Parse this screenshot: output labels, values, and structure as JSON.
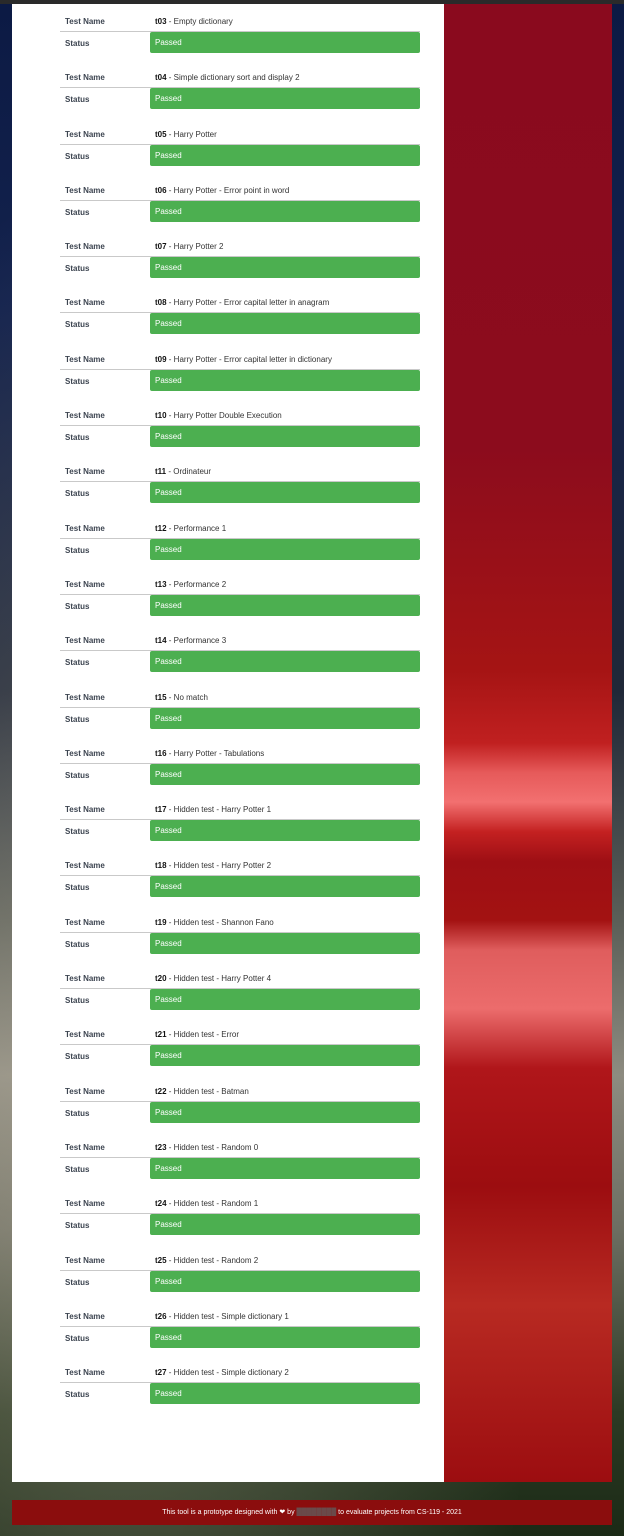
{
  "labels": {
    "test_name": "Test Name",
    "status": "Status",
    "separator": " - "
  },
  "tests": [
    {
      "id": "t03",
      "name": "Empty dictionary",
      "status": "Passed"
    },
    {
      "id": "t04",
      "name": "Simple dictionary sort and display 2",
      "status": "Passed"
    },
    {
      "id": "t05",
      "name": "Harry Potter",
      "status": "Passed"
    },
    {
      "id": "t06",
      "name": "Harry Potter - Error point in word",
      "status": "Passed"
    },
    {
      "id": "t07",
      "name": "Harry Potter 2",
      "status": "Passed"
    },
    {
      "id": "t08",
      "name": "Harry Potter - Error capital letter in anagram",
      "status": "Passed"
    },
    {
      "id": "t09",
      "name": "Harry Potter - Error capital letter in dictionary",
      "status": "Passed"
    },
    {
      "id": "t10",
      "name": "Harry Potter Double Execution",
      "status": "Passed"
    },
    {
      "id": "t11",
      "name": "Ordinateur",
      "status": "Passed"
    },
    {
      "id": "t12",
      "name": "Performance 1",
      "status": "Passed"
    },
    {
      "id": "t13",
      "name": "Performance 2",
      "status": "Passed"
    },
    {
      "id": "t14",
      "name": "Performance 3",
      "status": "Passed"
    },
    {
      "id": "t15",
      "name": "No match",
      "status": "Passed"
    },
    {
      "id": "t16",
      "name": "Harry Potter - Tabulations",
      "status": "Passed"
    },
    {
      "id": "t17",
      "name": "Hidden test - Harry Potter 1",
      "status": "Passed"
    },
    {
      "id": "t18",
      "name": "Hidden test - Harry Potter 2",
      "status": "Passed"
    },
    {
      "id": "t19",
      "name": "Hidden test - Shannon Fano",
      "status": "Passed"
    },
    {
      "id": "t20",
      "name": "Hidden test - Harry Potter 4",
      "status": "Passed"
    },
    {
      "id": "t21",
      "name": "Hidden test - Error",
      "status": "Passed"
    },
    {
      "id": "t22",
      "name": "Hidden test - Batman",
      "status": "Passed"
    },
    {
      "id": "t23",
      "name": "Hidden test - Random 0",
      "status": "Passed"
    },
    {
      "id": "t24",
      "name": "Hidden test - Random 1",
      "status": "Passed"
    },
    {
      "id": "t25",
      "name": "Hidden test - Random 2",
      "status": "Passed"
    },
    {
      "id": "t26",
      "name": "Hidden test - Simple dictionary 1",
      "status": "Passed"
    },
    {
      "id": "t27",
      "name": "Hidden test - Simple dictionary 2",
      "status": "Passed"
    }
  ],
  "footer": {
    "prefix": "This tool is a prototype designed with",
    "heart_icon": "heart-icon",
    "by": "by",
    "suffix": "to evaluate projects from CS-119 - 2021"
  },
  "colors": {
    "passed": "#4caf50",
    "accent": "#8b0d0d"
  }
}
